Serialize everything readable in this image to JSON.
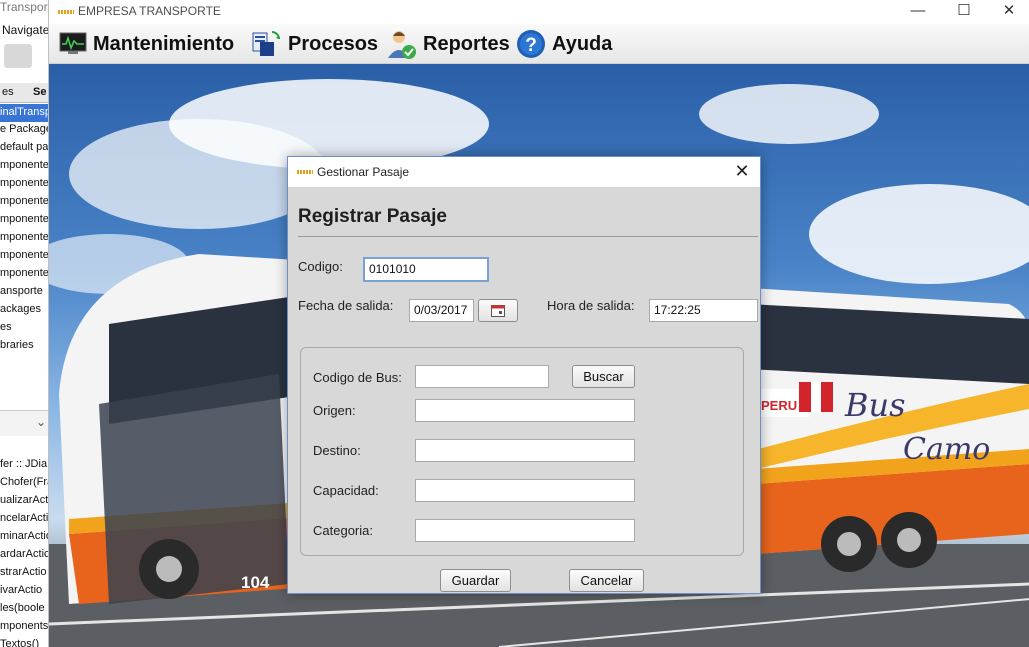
{
  "ide": {
    "title": "Transport",
    "menu": "Navigate",
    "col1": "es",
    "col2": "Se",
    "tree": [
      "inalTransp",
      "e Packages",
      "default pa",
      "mponente",
      "mponente",
      "mponente",
      "mponente",
      "mponente",
      "mponente",
      "mponente",
      "ansporte",
      "ackages",
      "es",
      "braries"
    ],
    "nav": [
      "fer :: JDia",
      "Chofer(Fra",
      "ualizarAct",
      "ncelarActio",
      "minarActio",
      "ardarActio",
      "strarActio",
      "ivarActio",
      "les(boole",
      "mponents(",
      "Textos()"
    ]
  },
  "window": {
    "title": "EMPRESA TRANSPORTE",
    "minimize": "—",
    "maximize": "☐",
    "close": "✕"
  },
  "menubar": {
    "items": [
      {
        "label": "Mantenimiento",
        "icon": "monitor-icon"
      },
      {
        "label": "Procesos",
        "icon": "process-sync-icon"
      },
      {
        "label": "Reportes",
        "icon": "user-check-icon"
      },
      {
        "label": "Ayuda",
        "icon": "help-icon"
      }
    ]
  },
  "dialog": {
    "title": "Gestionar Pasaje",
    "heading": "Registrar Pasaje",
    "codigo_label": "Codigo:",
    "codigo_value": "0101010",
    "fecha_label": "Fecha de salida:",
    "fecha_value": "0/03/2017",
    "hora_label": "Hora de salida:",
    "hora_value": "17:22:25",
    "bus_label": "Codigo de Bus:",
    "bus_value": "",
    "buscar": "Buscar",
    "origen_label": "Origen:",
    "origen_value": "",
    "destino_label": "Destino:",
    "destino_value": "",
    "capacidad_label": "Capacidad:",
    "capacidad_value": "",
    "categoria_label": "Categoria:",
    "categoria_value": "",
    "guardar": "Guardar",
    "cancelar": "Cancelar"
  },
  "bus": {
    "number": "104",
    "brand": "PERU",
    "script1": "Bus",
    "script2": "Camo"
  }
}
